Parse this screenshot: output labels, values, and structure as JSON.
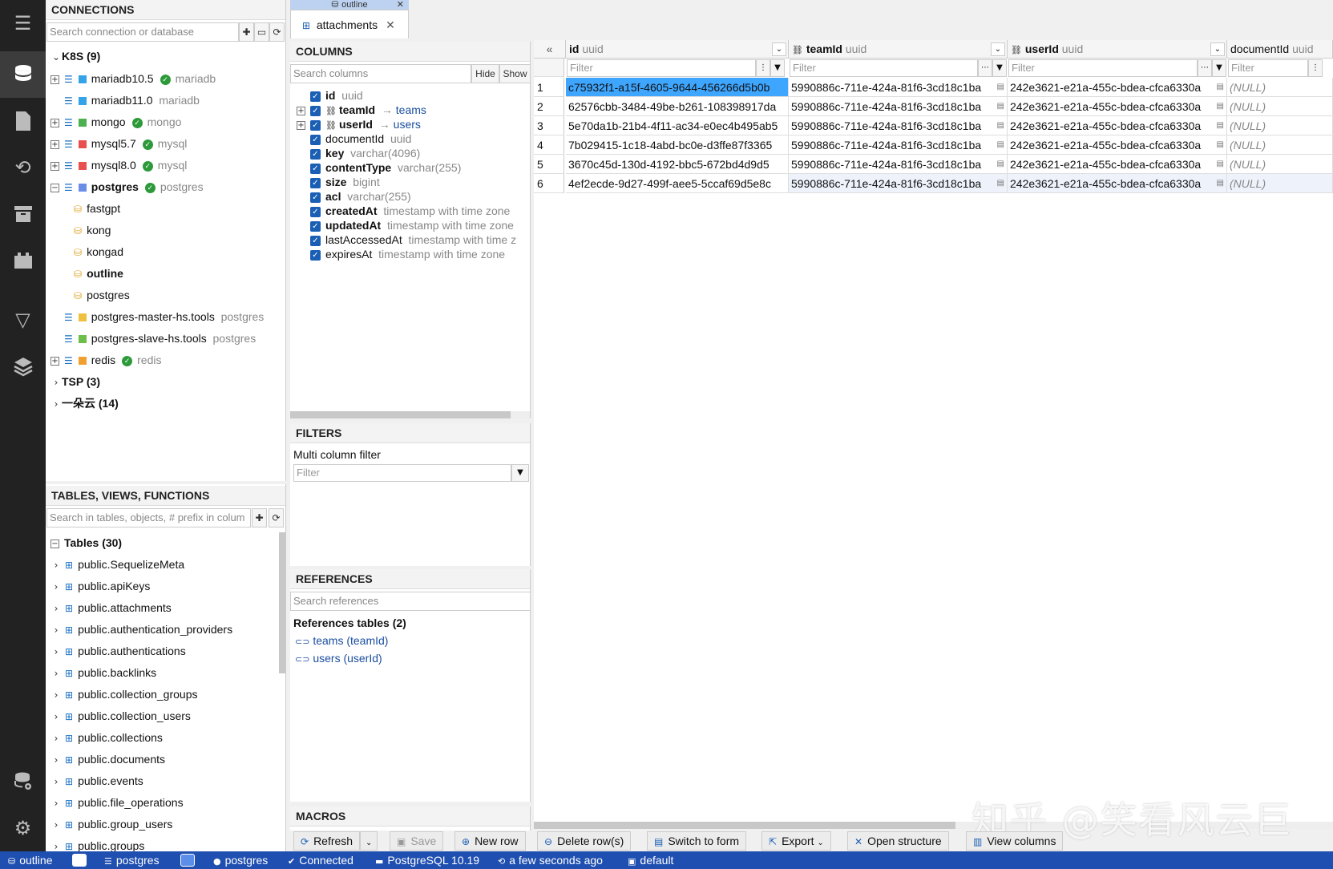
{
  "connections": {
    "title": "CONNECTIONS",
    "search_placeholder": "Search connection or database",
    "groups": {
      "k8s": "K8S (9)",
      "tsp": "TSP (3)",
      "yiduoyun": "一朵云 (14)"
    },
    "items": [
      {
        "name": "mariadb10.5",
        "engine": "mariadb",
        "color": "#35a3e8"
      },
      {
        "name": "mariadb11.0",
        "engine": "mariadb",
        "color": "#35a3e8"
      },
      {
        "name": "mongo",
        "engine": "mongo",
        "color": "#4caf50"
      },
      {
        "name": "mysql5.7",
        "engine": "mysql",
        "color": "#e85050"
      },
      {
        "name": "mysql8.0",
        "engine": "mysql",
        "color": "#e85050"
      },
      {
        "name": "postgres",
        "engine": "postgres",
        "color": "#6a8ee8"
      },
      {
        "name": "postgres-master-hs.tools",
        "engine": "postgres",
        "color": "#f0c040"
      },
      {
        "name": "postgres-slave-hs.tools",
        "engine": "postgres",
        "color": "#6cc04a"
      },
      {
        "name": "redis",
        "engine": "redis",
        "color": "#f0a030"
      }
    ],
    "databases": [
      "fastgpt",
      "kong",
      "kongad",
      "outline",
      "postgres"
    ]
  },
  "tables_panel": {
    "title": "TABLES, VIEWS, FUNCTIONS",
    "search_placeholder": "Search in tables, objects, # prefix in colum",
    "group": "Tables (30)",
    "tables": [
      "public.SequelizeMeta",
      "public.apiKeys",
      "public.attachments",
      "public.authentication_providers",
      "public.authentications",
      "public.backlinks",
      "public.collection_groups",
      "public.collection_users",
      "public.collections",
      "public.documents",
      "public.events",
      "public.file_operations",
      "public.group_users",
      "public.groups"
    ]
  },
  "tabs": {
    "outline_tab": "outline",
    "active_tab": "attachments"
  },
  "columns_panel": {
    "title": "COLUMNS",
    "search_placeholder": "Search columns",
    "hide": "Hide",
    "show": "Show",
    "columns": [
      {
        "name": "id",
        "type": "uuid"
      },
      {
        "name": "teamId",
        "type": "teams"
      },
      {
        "name": "userId",
        "type": "users"
      },
      {
        "name": "documentId",
        "type": "uuid"
      },
      {
        "name": "key",
        "type": "varchar(4096)"
      },
      {
        "name": "contentType",
        "type": "varchar(255)"
      },
      {
        "name": "size",
        "type": "bigint"
      },
      {
        "name": "acl",
        "type": "varchar(255)"
      },
      {
        "name": "createdAt",
        "type": "timestamp with time zone"
      },
      {
        "name": "updatedAt",
        "type": "timestamp with time zone"
      },
      {
        "name": "lastAccessedAt",
        "type": "timestamp with time z"
      },
      {
        "name": "expiresAt",
        "type": "timestamp with time zone"
      }
    ]
  },
  "filters_panel": {
    "title": "FILTERS",
    "multi_label": "Multi column filter",
    "placeholder": "Filter"
  },
  "references_panel": {
    "title": "REFERENCES",
    "search_placeholder": "Search references",
    "group": "References tables (2)",
    "refs": [
      "teams (teamId)",
      "users (userId)"
    ]
  },
  "macros_panel": {
    "title": "MACROS"
  },
  "grid": {
    "headers": [
      {
        "name": "id",
        "type": "uuid"
      },
      {
        "name": "teamId",
        "type": "uuid"
      },
      {
        "name": "userId",
        "type": "uuid"
      },
      {
        "name": "documentId",
        "type": "uuid"
      }
    ],
    "filter_placeholder": "Filter",
    "rows": [
      {
        "n": "1",
        "id": "c75932f1-a15f-4605-9644-456266d5b0b",
        "teamId": "5990886c-711e-424a-81f6-3cd18c1ba",
        "userId": "242e3621-e21a-455c-bdea-cfca6330a",
        "documentId": "(NULL)"
      },
      {
        "n": "2",
        "id": "62576cbb-3484-49be-b261-108398917da",
        "teamId": "5990886c-711e-424a-81f6-3cd18c1ba",
        "userId": "242e3621-e21a-455c-bdea-cfca6330a",
        "documentId": "(NULL)"
      },
      {
        "n": "3",
        "id": "5e70da1b-21b4-4f11-ac34-e0ec4b495ab5",
        "teamId": "5990886c-711e-424a-81f6-3cd18c1ba",
        "userId": "242e3621-e21a-455c-bdea-cfca6330a",
        "documentId": "(NULL)"
      },
      {
        "n": "4",
        "id": "7b029415-1c18-4abd-bc0e-d3ffe87f3365",
        "teamId": "5990886c-711e-424a-81f6-3cd18c1ba",
        "userId": "242e3621-e21a-455c-bdea-cfca6330a",
        "documentId": "(NULL)"
      },
      {
        "n": "5",
        "id": "3670c45d-130d-4192-bbc5-672bd4d9d5",
        "teamId": "5990886c-711e-424a-81f6-3cd18c1ba",
        "userId": "242e3621-e21a-455c-bdea-cfca6330a",
        "documentId": "(NULL)"
      },
      {
        "n": "6",
        "id": "4ef2ecde-9d27-499f-aee5-5ccaf69d5e8c",
        "teamId": "5990886c-711e-424a-81f6-3cd18c1ba",
        "userId": "242e3621-e21a-455c-bdea-cfca6330a",
        "documentId": "(NULL)"
      }
    ]
  },
  "toolbar": {
    "refresh": "Refresh",
    "save": "Save",
    "new_row": "New row",
    "delete_rows": "Delete row(s)",
    "switch_form": "Switch to form",
    "export": "Export",
    "open_structure": "Open structure",
    "view_columns": "View columns"
  },
  "statusbar": {
    "database": "outline",
    "server": "postgres",
    "user": "postgres",
    "connection": "Connected",
    "version": "PostgreSQL 10.19",
    "time": "a few seconds ago",
    "schema": "default"
  },
  "watermark": "知乎 @笑看风云巨",
  "colors": {
    "accent": "#1f4fb0",
    "sidebar": "#222222",
    "selection": "#3ea6ff"
  }
}
